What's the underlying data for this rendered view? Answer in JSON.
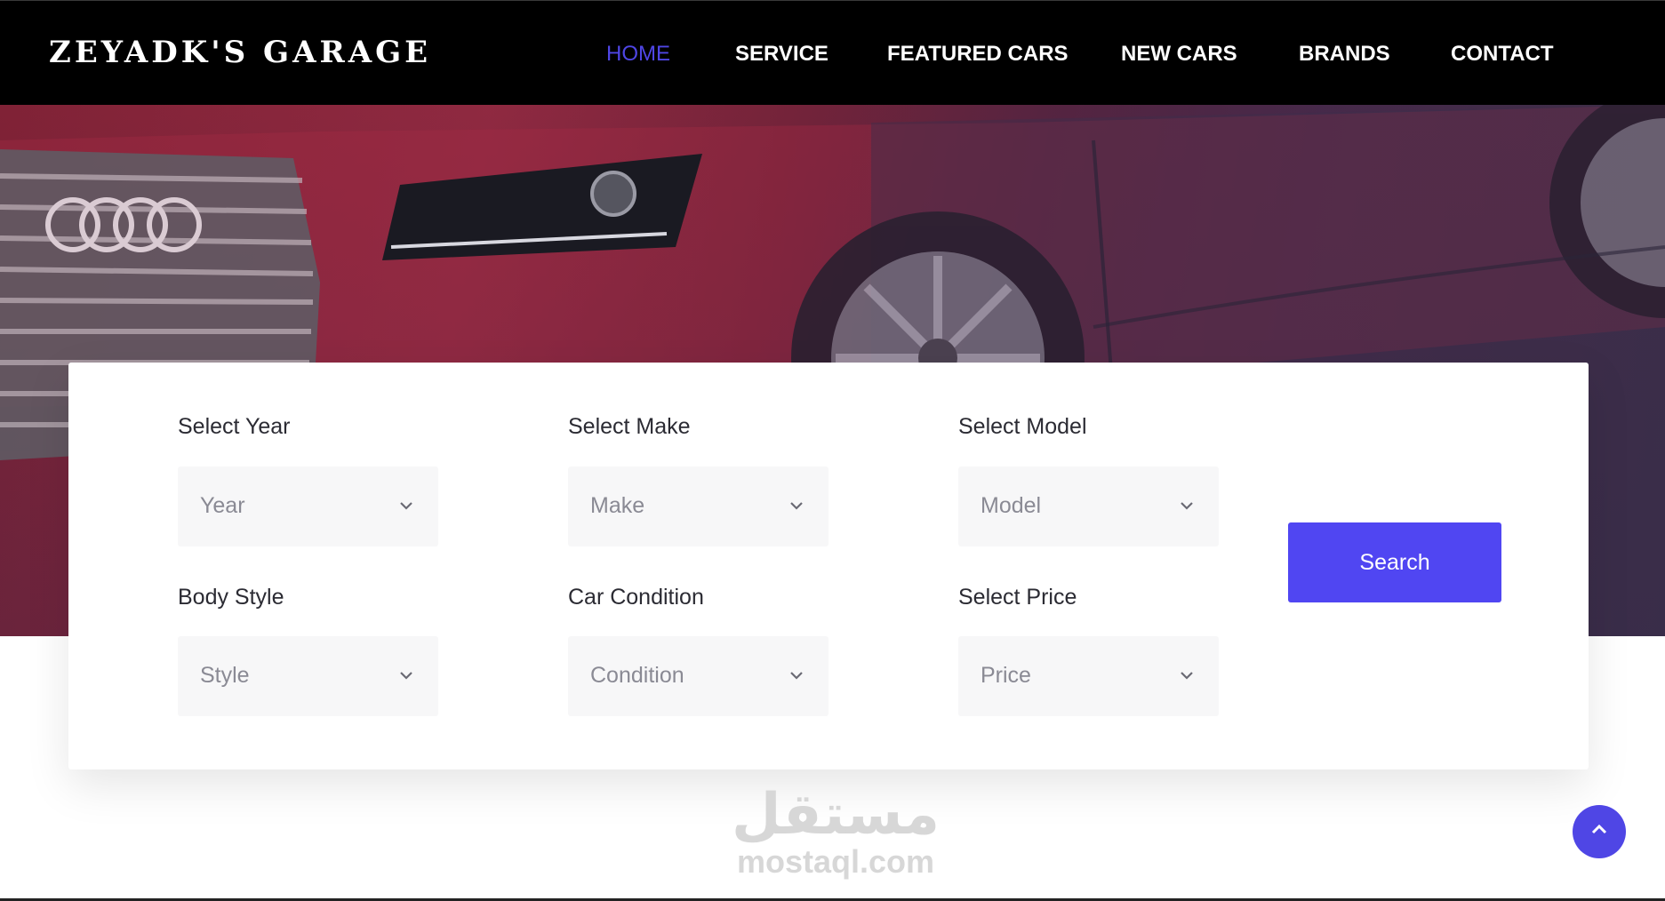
{
  "header": {
    "brand": "ZEYADK'S GARAGE",
    "nav": [
      {
        "label": "HOME",
        "active": true
      },
      {
        "label": "SERVICE",
        "active": false
      },
      {
        "label": "FEATURED CARS",
        "active": false
      },
      {
        "label": "NEW CARS",
        "active": false
      },
      {
        "label": "BRANDS",
        "active": false
      },
      {
        "label": "CONTACT",
        "active": false
      }
    ]
  },
  "search_form": {
    "fields": [
      {
        "label": "Select Year",
        "value": "Year"
      },
      {
        "label": "Select Make",
        "value": "Make"
      },
      {
        "label": "Select Model",
        "value": "Model"
      },
      {
        "label": "Body Style",
        "value": "Style"
      },
      {
        "label": "Car Condition",
        "value": "Condition"
      },
      {
        "label": "Select Price",
        "value": "Price"
      }
    ],
    "search_label": "Search"
  },
  "watermark": {
    "arabic": "مستقل",
    "latin": "mostaql.com"
  },
  "icons": {
    "select_chevron": "chevron-down-icon",
    "back_to_top": "chevron-up-icon"
  },
  "colors": {
    "accent": "#4f46e5",
    "button": "#5046f2",
    "header_bg": "#000000",
    "select_bg": "#f7f7f8"
  }
}
